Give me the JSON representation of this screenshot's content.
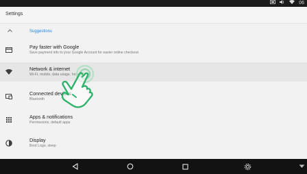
{
  "status_bar": {
    "time": "06",
    "icons": [
      "screenshot-icon",
      "volume-icon",
      "wifi-icon"
    ]
  },
  "app_bar": {
    "title": "Settings"
  },
  "suggestions": {
    "label": "Suggestions",
    "expanded": true
  },
  "items": [
    {
      "icon": "payment-card-icon",
      "title": "Pay faster with Google",
      "subtitle": "Save payment info to your Google Account for easier online checkout"
    },
    {
      "icon": "wifi-icon",
      "title": "Network & internet",
      "subtitle": "Wi-Fi, mobile, data usage, hotspot"
    },
    {
      "icon": "connected-devices-icon",
      "title": "Connected devices",
      "subtitle": "Bluetooth"
    },
    {
      "icon": "apps-grid-icon",
      "title": "Apps & notifications",
      "subtitle": "Permissions, default apps"
    },
    {
      "icon": "display-icon",
      "title": "Display",
      "subtitle": "Boot Logo, sleep"
    }
  ],
  "nav_bar": {
    "buttons": [
      "back-icon",
      "home-icon",
      "recents-icon",
      "settings-gear-icon",
      "menu-down-icon"
    ]
  },
  "colors": {
    "accent": "#1e88e5",
    "status_bar": "#1b1b1b",
    "nav_bar": "#121212",
    "background": "#f2f2f2",
    "highlight": "#e6e6e6"
  }
}
